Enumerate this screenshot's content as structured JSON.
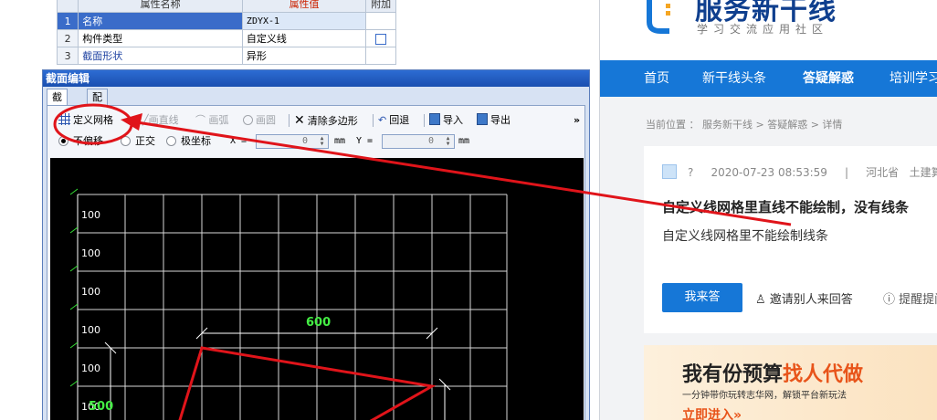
{
  "property_table": {
    "headers": [
      "属性名称",
      "属性值",
      "附加"
    ],
    "rows": [
      {
        "num": "1",
        "name": "名称",
        "value": "ZDYX-1"
      },
      {
        "num": "2",
        "name": "构件类型",
        "value": "自定义线"
      },
      {
        "num": "3",
        "name": "截面形状",
        "value": "异形"
      }
    ]
  },
  "dialog": {
    "title": "截面编辑",
    "tabs": [
      "截面",
      "配筋"
    ],
    "toolbar": {
      "define_grid": "定义网格",
      "draw_line": "画直线",
      "draw_arc": "画弧",
      "draw_circle": "画圆",
      "clear_polygon": "清除多边形",
      "undo": "回退",
      "import": "导入",
      "export": "导出",
      "more": "»"
    },
    "coords": {
      "no_offset": "不偏移",
      "orthogonal": "正交",
      "polar": "极坐标",
      "x_label": "X =",
      "x_value": "0",
      "x_unit": "mm",
      "y_label": "Y =",
      "y_value": "0",
      "y_unit": "mm"
    },
    "canvas": {
      "row_labels": [
        "100",
        "100",
        "100",
        "100",
        "100",
        "100"
      ],
      "dim_top": "600",
      "dim_left": "500"
    }
  },
  "site": {
    "brand": "服务新干线",
    "slogan": "学习交流应用社区",
    "nav": [
      "首页",
      "新干线头条",
      "答疑解惑",
      "培训学习"
    ],
    "breadcrumb": "当前位置 ： 服务新干线 > 答疑解惑 > 详情",
    "meta": {
      "user": "?",
      "date": "2020-07-23 08:53:59",
      "sep": "|",
      "region": "河北省",
      "category": "土建算量"
    },
    "question_title": "自定义线网格里直线不能绘制，没有线条",
    "question_body": "自定义线网格里不能绘制线条",
    "answer_button": "我来答",
    "invite": "邀请别人来回答",
    "remind": "提醒提问",
    "ad": {
      "title_prefix": "我有份预算",
      "title_highlight": "找人代做",
      "subtitle": "一分钟带你玩转志华网，解锁平台新玩法",
      "link": "立即进入»"
    }
  },
  "colors": {
    "accent": "#1677d7",
    "annotation": "#e0141a",
    "grid_dimension": "#44ee44"
  }
}
